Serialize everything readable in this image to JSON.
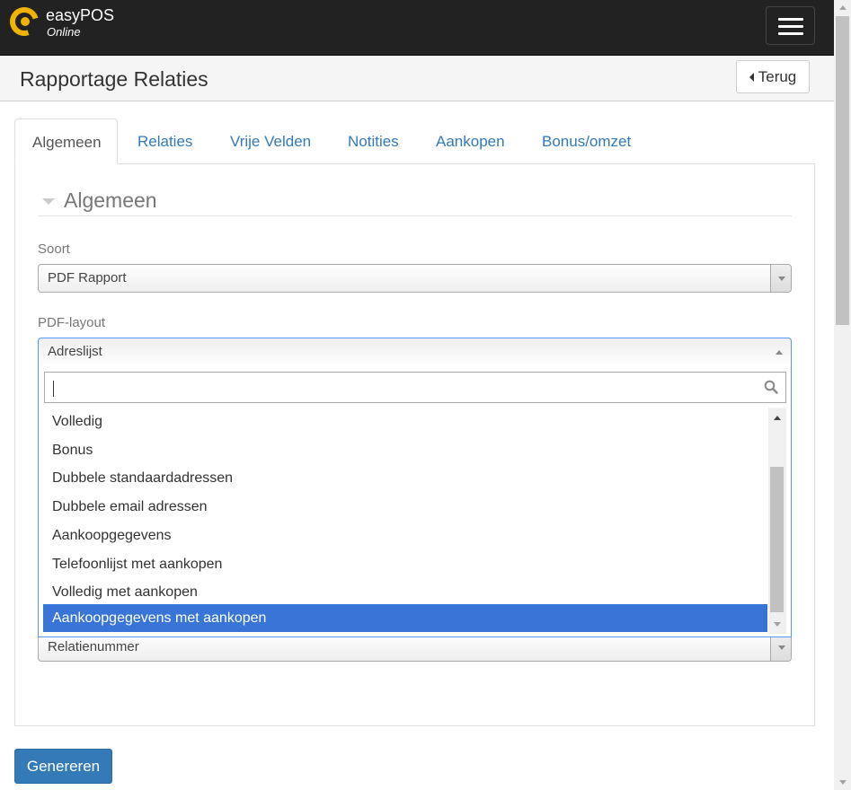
{
  "navbar": {
    "brand_name": "easyPOS",
    "brand_sub": "Online",
    "logo_icon": "easypos-logo-icon",
    "menu_icon": "hamburger-icon"
  },
  "header": {
    "title": "Rapportage Relaties",
    "back_label": "Terug"
  },
  "tabs": [
    {
      "label": "Algemeen",
      "active": true
    },
    {
      "label": "Relaties"
    },
    {
      "label": "Vrije Velden"
    },
    {
      "label": "Notities"
    },
    {
      "label": "Aankopen"
    },
    {
      "label": "Bonus/omzet"
    }
  ],
  "section": {
    "title": "Algemeen"
  },
  "form": {
    "soort_label": "Soort",
    "soort_value": "PDF Rapport",
    "layout_label": "PDF-layout",
    "layout_value": "Adreslijst",
    "hidden_select_value": "Relatienummer"
  },
  "dropdown": {
    "search_value": "",
    "options": [
      "Volledig",
      "Bonus",
      "Dubbele standaardadressen",
      "Dubbele email adressen",
      "Aankoopgegevens",
      "Telefoonlijst met aankopen",
      "Volledig met aankopen",
      "Aankoopgegevens met aankopen"
    ],
    "highlighted": "Aankoopgegevens met aankopen"
  },
  "actions": {
    "generate_label": "Genereren"
  },
  "colors": {
    "navbar": "#222222",
    "primary": "#337ab7",
    "highlight": "#3875d7",
    "logo": "#f0b400"
  }
}
